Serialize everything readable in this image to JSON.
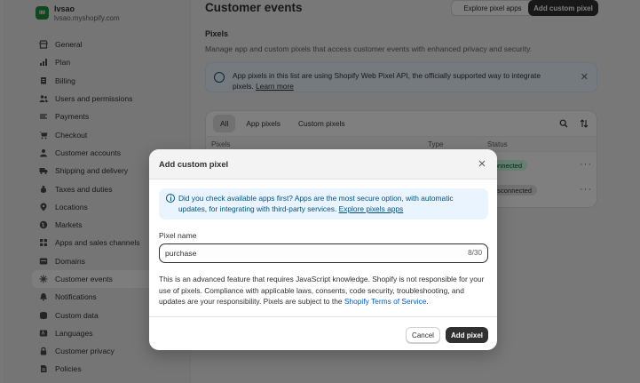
{
  "store": {
    "logo_text": "IM",
    "name": "lvsao",
    "domain": "lvsao.myshopify.com"
  },
  "sidebar": {
    "items": [
      {
        "label": "General",
        "icon": "store-icon"
      },
      {
        "label": "Plan",
        "icon": "plan-chart-icon"
      },
      {
        "label": "Billing",
        "icon": "billing-receipt-icon"
      },
      {
        "label": "Users and permissions",
        "icon": "users-icon"
      },
      {
        "label": "Payments",
        "icon": "payments-icon"
      },
      {
        "label": "Checkout",
        "icon": "cart-icon"
      },
      {
        "label": "Customer accounts",
        "icon": "person-icon"
      },
      {
        "label": "Shipping and delivery",
        "icon": "truck-icon"
      },
      {
        "label": "Taxes and duties",
        "icon": "tax-bag-icon"
      },
      {
        "label": "Locations",
        "icon": "location-pin-icon"
      },
      {
        "label": "Markets",
        "icon": "globe-icon"
      },
      {
        "label": "Apps and sales channels",
        "icon": "apps-grid-icon"
      },
      {
        "label": "Domains",
        "icon": "domain-globe-icon"
      },
      {
        "label": "Customer events",
        "icon": "sparkle-events-icon",
        "active": true
      },
      {
        "label": "Notifications",
        "icon": "bell-icon"
      },
      {
        "label": "Custom data",
        "icon": "database-icon"
      },
      {
        "label": "Languages",
        "icon": "language-icon"
      },
      {
        "label": "Customer privacy",
        "icon": "lock-icon"
      },
      {
        "label": "Policies",
        "icon": "policy-document-icon"
      }
    ]
  },
  "header": {
    "title": "Customer events",
    "explore_label": "Explore pixel apps",
    "add_label": "Add custom pixel"
  },
  "pixels_section": {
    "title": "Pixels",
    "description": "Manage app and custom pixels that access customer events with enhanced privacy and security.",
    "banner_text": "App pixels in this list are using Shopify Web Pixel API, the officially supported way to integrate pixels.",
    "banner_link": "Learn more",
    "tabs": [
      "All",
      "App pixels",
      "Custom pixels"
    ],
    "columns": [
      "Pixels",
      "Type",
      "Status"
    ],
    "rows": [
      {
        "status": "connected"
      },
      {
        "status": "Disconnected"
      }
    ]
  },
  "modal": {
    "title": "Add custom pixel",
    "banner_text": "Did you check available apps first? Apps are the most secure option, with automatic updates, for integrating with third-party services.",
    "banner_link": "Explore pixels apps",
    "field_label": "Pixel name",
    "field_value": "purchase",
    "field_counter": "8/30",
    "description": "This is an advanced feature that requires JavaScript knowledge. Shopify is not responsible for your use of pixels. Compliance with applicable laws, consents, code security, troubleshooting, and updates are your responsibility. Pixels are subject to the",
    "terms_link": "Shopify Terms of Service",
    "terms_suffix": ".",
    "cancel_label": "Cancel",
    "submit_label": "Add pixel"
  },
  "colors": {
    "primary_button": "#303030",
    "info_banner_bg": "#eaf4ff",
    "info_text": "#00527c",
    "link": "#005bd3",
    "status_connected": "#cdfee1",
    "overlay": "rgba(0,0,0,0.5)"
  }
}
